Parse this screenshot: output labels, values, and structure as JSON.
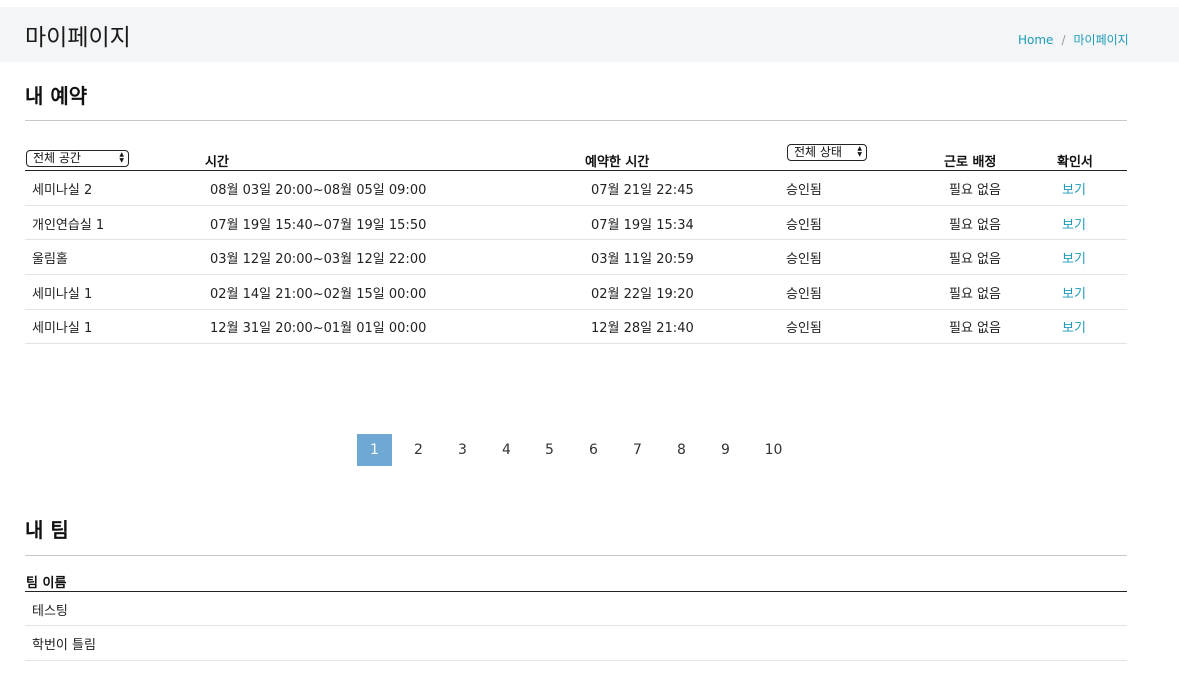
{
  "header": {
    "title": "마이페이지",
    "breadcrumb": {
      "home": "Home",
      "separator": "/",
      "current": "마이페이지"
    }
  },
  "reservations": {
    "title": "내 예약",
    "filters": {
      "space": "전체 공간",
      "status": "전체 상태"
    },
    "columns": {
      "time": "시간",
      "reserved_time": "예약한 시간",
      "work": "근로 배정",
      "confirm": "확인서"
    },
    "rows": [
      {
        "space": "세미나실 2",
        "time": "08월 03일 20:00~08월 05일 09:00",
        "reserved": "07월 21일 22:45",
        "status": "승인됨",
        "work": "필요 없음",
        "confirm": "보기"
      },
      {
        "space": "개인연습실 1",
        "time": "07월 19일 15:40~07월 19일 15:50",
        "reserved": "07월 19일 15:34",
        "status": "승인됨",
        "work": "필요 없음",
        "confirm": "보기"
      },
      {
        "space": "울림홀",
        "time": "03월 12일 20:00~03월 12일 22:00",
        "reserved": "03월 11일 20:59",
        "status": "승인됨",
        "work": "필요 없음",
        "confirm": "보기"
      },
      {
        "space": "세미나실 1",
        "time": "02월 14일 21:00~02월 15일 00:00",
        "reserved": "02월 22일 19:20",
        "status": "승인됨",
        "work": "필요 없음",
        "confirm": "보기"
      },
      {
        "space": "세미나실 1",
        "time": "12월 31일 20:00~01월 01일 00:00",
        "reserved": "12월 28일 21:40",
        "status": "승인됨",
        "work": "필요 없음",
        "confirm": "보기"
      }
    ]
  },
  "pagination": {
    "pages": [
      "1",
      "2",
      "3",
      "4",
      "5",
      "6",
      "7",
      "8",
      "9",
      "10"
    ],
    "active": "1",
    "active_color": "#6ea8d3"
  },
  "teams": {
    "title": "내 팀",
    "column": "팀 이름",
    "rows": [
      "테스팅",
      "학번이 틀림"
    ]
  }
}
